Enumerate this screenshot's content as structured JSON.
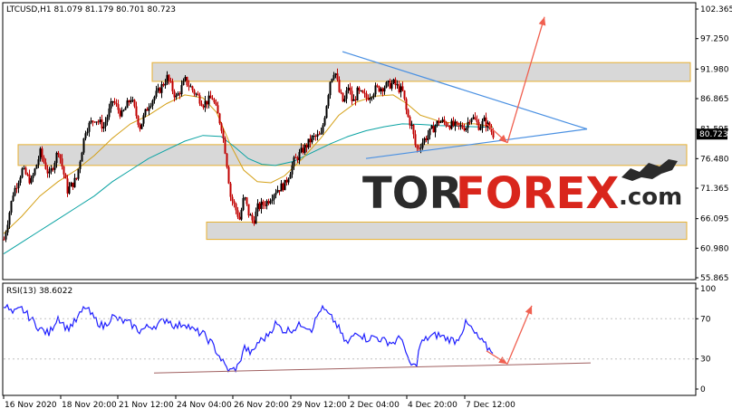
{
  "chart_data": [
    {
      "type": "candlestick",
      "title": "LTCUSD,H1  81.079 81.179 80.701 80.723",
      "symbol": "LTCUSD",
      "timeframe": "H1",
      "ohlc_header": {
        "open": 81.079,
        "high": 81.179,
        "low": 80.701,
        "close": 80.723
      },
      "ylim": [
        55.865,
        102.365
      ],
      "yticks": [
        "102.365",
        "97.250",
        "91.980",
        "86.865",
        "81.595",
        "76.480",
        "71.365",
        "66.095",
        "60.980",
        "55.865"
      ],
      "current_price": "80.723",
      "x_ticks": [
        "16 Nov 2020",
        "18 Nov 20:00",
        "21 Nov 12:00",
        "24 Nov 04:00",
        "26 Nov 20:00",
        "29 Nov 12:00",
        "2 Dec 04:00",
        "4 Dec 20:00",
        "7 Dec 12:00"
      ],
      "close_path": [
        [
          0,
          62.5
        ],
        [
          10,
          70.5
        ],
        [
          20,
          74.5
        ],
        [
          30,
          72.5
        ],
        [
          40,
          77.5
        ],
        [
          50,
          73.5
        ],
        [
          60,
          78
        ],
        [
          70,
          71
        ],
        [
          80,
          73
        ],
        [
          90,
          81.5
        ],
        [
          100,
          83.5
        ],
        [
          110,
          82
        ],
        [
          120,
          86.5
        ],
        [
          130,
          84
        ],
        [
          140,
          87
        ],
        [
          150,
          82
        ],
        [
          160,
          86
        ],
        [
          170,
          88
        ],
        [
          180,
          90.5
        ],
        [
          190,
          87
        ],
        [
          200,
          90
        ],
        [
          210,
          88
        ],
        [
          220,
          86
        ],
        [
          230,
          87
        ],
        [
          240,
          82
        ],
        [
          245,
          77
        ],
        [
          250,
          70
        ],
        [
          255,
          68
        ],
        [
          260,
          66
        ],
        [
          265,
          70
        ],
        [
          270,
          67
        ],
        [
          275,
          65.5
        ],
        [
          280,
          68
        ],
        [
          290,
          69
        ],
        [
          300,
          71
        ],
        [
          310,
          72
        ],
        [
          320,
          76
        ],
        [
          330,
          78
        ],
        [
          340,
          80
        ],
        [
          350,
          80.5
        ],
        [
          355,
          85
        ],
        [
          360,
          90
        ],
        [
          365,
          92
        ],
        [
          370,
          88
        ],
        [
          375,
          86
        ],
        [
          380,
          89
        ],
        [
          385,
          86
        ],
        [
          390,
          88
        ],
        [
          400,
          87
        ],
        [
          410,
          88.5
        ],
        [
          420,
          89
        ],
        [
          430,
          89.5
        ],
        [
          440,
          88
        ],
        [
          445,
          84
        ],
        [
          450,
          82
        ],
        [
          455,
          78
        ],
        [
          460,
          79
        ],
        [
          470,
          81
        ],
        [
          480,
          83
        ],
        [
          490,
          82.5
        ],
        [
          500,
          82
        ],
        [
          510,
          82
        ],
        [
          515,
          84
        ],
        [
          520,
          83
        ],
        [
          525,
          82
        ],
        [
          530,
          83
        ],
        [
          535,
          82
        ],
        [
          540,
          80.7
        ]
      ],
      "ma_slow": [
        [
          0,
          60
        ],
        [
          20,
          62
        ],
        [
          40,
          64
        ],
        [
          60,
          66
        ],
        [
          80,
          68
        ],
        [
          100,
          70
        ],
        [
          120,
          72.5
        ],
        [
          140,
          74.5
        ],
        [
          160,
          76.5
        ],
        [
          180,
          78
        ],
        [
          200,
          79.5
        ],
        [
          220,
          80.5
        ],
        [
          240,
          80.3
        ],
        [
          255,
          78.5
        ],
        [
          270,
          76.5
        ],
        [
          285,
          75.5
        ],
        [
          300,
          75.3
        ],
        [
          320,
          76
        ],
        [
          340,
          77.5
        ],
        [
          360,
          79
        ],
        [
          380,
          80.3
        ],
        [
          400,
          81.3
        ],
        [
          420,
          82
        ],
        [
          440,
          82.5
        ],
        [
          460,
          82.4
        ],
        [
          480,
          82.2
        ],
        [
          500,
          82.1
        ],
        [
          520,
          82
        ],
        [
          540,
          81.9
        ]
      ],
      "ma_fast": [
        [
          0,
          63.5
        ],
        [
          20,
          66.5
        ],
        [
          40,
          70
        ],
        [
          60,
          72.5
        ],
        [
          80,
          74.5
        ],
        [
          100,
          77
        ],
        [
          120,
          80
        ],
        [
          140,
          82.5
        ],
        [
          160,
          84
        ],
        [
          180,
          86
        ],
        [
          200,
          87.5
        ],
        [
          220,
          87
        ],
        [
          235,
          84.5
        ],
        [
          250,
          79
        ],
        [
          265,
          74.5
        ],
        [
          280,
          72.5
        ],
        [
          295,
          72.3
        ],
        [
          310,
          73.5
        ],
        [
          330,
          76.5
        ],
        [
          350,
          80
        ],
        [
          370,
          84
        ],
        [
          390,
          86.3
        ],
        [
          410,
          87.3
        ],
        [
          430,
          87.5
        ],
        [
          445,
          86
        ],
        [
          460,
          84
        ],
        [
          480,
          83
        ],
        [
          500,
          82.5
        ],
        [
          520,
          82.5
        ],
        [
          540,
          82
        ]
      ],
      "zones": [
        {
          "x1": 168,
          "x2": 762,
          "y1": 89.85,
          "y2": 93.1
        },
        {
          "x1": 20,
          "x2": 758,
          "y1": 75.3,
          "y2": 78.9
        },
        {
          "x1": 228,
          "x2": 758,
          "y1": 62.5,
          "y2": 65.5
        }
      ],
      "triangle_lines": [
        {
          "x1": 378,
          "y1": 95,
          "x2": 648,
          "y2": 81.6
        },
        {
          "x1": 404,
          "y1": 76.5,
          "x2": 648,
          "y2": 81.6
        }
      ],
      "arrows": [
        {
          "x1": 537,
          "y1": 82.5,
          "x2": 560,
          "y2": 79.2
        },
        {
          "x1": 560,
          "y1": 79.2,
          "x2": 601,
          "y2": 101
        }
      ],
      "colors": {
        "bull": "#000000",
        "bear": "#c00000",
        "ma_slow": "#0aa3a3",
        "ma_fast": "#d4a017",
        "zone": "#d8d8d8",
        "zone_border": "#e8b030",
        "triangle": "#4a90e2",
        "arrow": "#f06050",
        "price_box": "#000000"
      }
    },
    {
      "type": "line",
      "title": "RSI(13) 38.6022",
      "ylim": [
        0,
        100
      ],
      "yticks": [
        "100",
        "70",
        "30",
        "0"
      ],
      "values": [
        [
          0,
          85
        ],
        [
          10,
          75
        ],
        [
          20,
          80
        ],
        [
          30,
          70
        ],
        [
          40,
          60
        ],
        [
          50,
          55
        ],
        [
          60,
          72
        ],
        [
          70,
          60
        ],
        [
          80,
          68
        ],
        [
          90,
          82
        ],
        [
          100,
          70
        ],
        [
          110,
          62
        ],
        [
          120,
          72
        ],
        [
          130,
          68
        ],
        [
          140,
          65
        ],
        [
          150,
          58
        ],
        [
          160,
          62
        ],
        [
          170,
          64
        ],
        [
          180,
          70
        ],
        [
          190,
          62
        ],
        [
          200,
          66
        ],
        [
          210,
          58
        ],
        [
          220,
          55
        ],
        [
          230,
          45
        ],
        [
          240,
          30
        ],
        [
          245,
          22
        ],
        [
          250,
          18
        ],
        [
          255,
          20
        ],
        [
          260,
          24
        ],
        [
          265,
          42
        ],
        [
          270,
          38
        ],
        [
          275,
          35
        ],
        [
          280,
          46
        ],
        [
          290,
          52
        ],
        [
          300,
          65
        ],
        [
          310,
          58
        ],
        [
          320,
          60
        ],
        [
          330,
          65
        ],
        [
          340,
          60
        ],
        [
          350,
          80
        ],
        [
          355,
          78
        ],
        [
          360,
          72
        ],
        [
          365,
          68
        ],
        [
          370,
          60
        ],
        [
          375,
          50
        ],
        [
          380,
          45
        ],
        [
          385,
          52
        ],
        [
          390,
          58
        ],
        [
          400,
          50
        ],
        [
          410,
          52
        ],
        [
          420,
          48
        ],
        [
          430,
          46
        ],
        [
          440,
          52
        ],
        [
          445,
          30
        ],
        [
          450,
          24
        ],
        [
          455,
          22
        ],
        [
          460,
          45
        ],
        [
          470,
          52
        ],
        [
          480,
          54
        ],
        [
          490,
          50
        ],
        [
          500,
          48
        ],
        [
          510,
          65
        ],
        [
          515,
          62
        ],
        [
          520,
          55
        ],
        [
          525,
          50
        ],
        [
          530,
          45
        ],
        [
          535,
          40
        ],
        [
          540,
          38.6
        ]
      ],
      "support_line": {
        "x1": 170,
        "y1": 16,
        "x2": 652,
        "y2": 26
      },
      "arrows": [
        {
          "x1": 537,
          "y1": 38,
          "x2": 560,
          "y2": 25
        },
        {
          "x1": 560,
          "y1": 25,
          "x2": 587,
          "y2": 83
        }
      ],
      "colors": {
        "line": "#1f1fff",
        "support": "#a06060",
        "arrow": "#f06050"
      }
    }
  ],
  "watermark": {
    "tor": "TOR",
    "forex": "FOREX",
    "dotcom": ".com"
  }
}
